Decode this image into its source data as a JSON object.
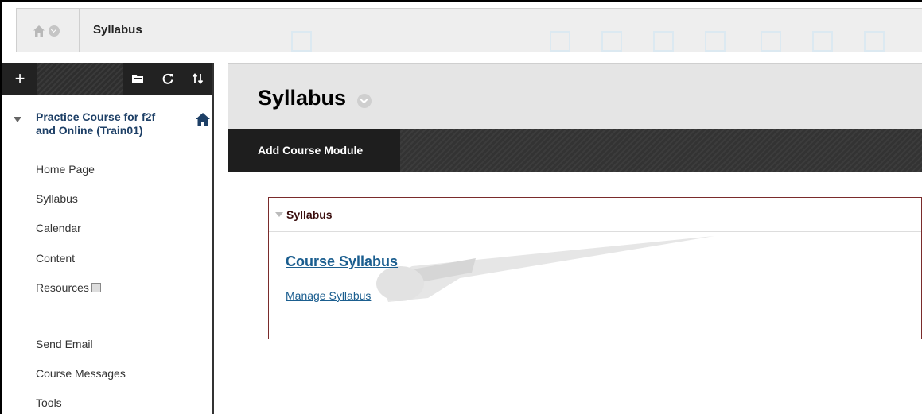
{
  "breadcrumb": {
    "current": "Syllabus"
  },
  "course_menu": {
    "toolbar": {
      "add_label": "+"
    },
    "course_title": "Practice Course for f2f and Online (Train01)",
    "items": [
      {
        "label": "Home Page"
      },
      {
        "label": "Syllabus"
      },
      {
        "label": "Calendar"
      },
      {
        "label": "Content"
      },
      {
        "label": "Resources"
      }
    ],
    "tools": [
      {
        "label": "Send Email"
      },
      {
        "label": "Course Messages"
      },
      {
        "label": "Tools"
      }
    ]
  },
  "page": {
    "title": "Syllabus",
    "action_button": "Add Course Module"
  },
  "module": {
    "title": "Syllabus",
    "link_title": "Course Syllabus",
    "manage_link": "Manage Syllabus"
  },
  "colors": {
    "menu_dark": "#222222",
    "course_title": "#1d3f66",
    "link": "#1b5e8f",
    "module_border": "#7a2b2b"
  }
}
